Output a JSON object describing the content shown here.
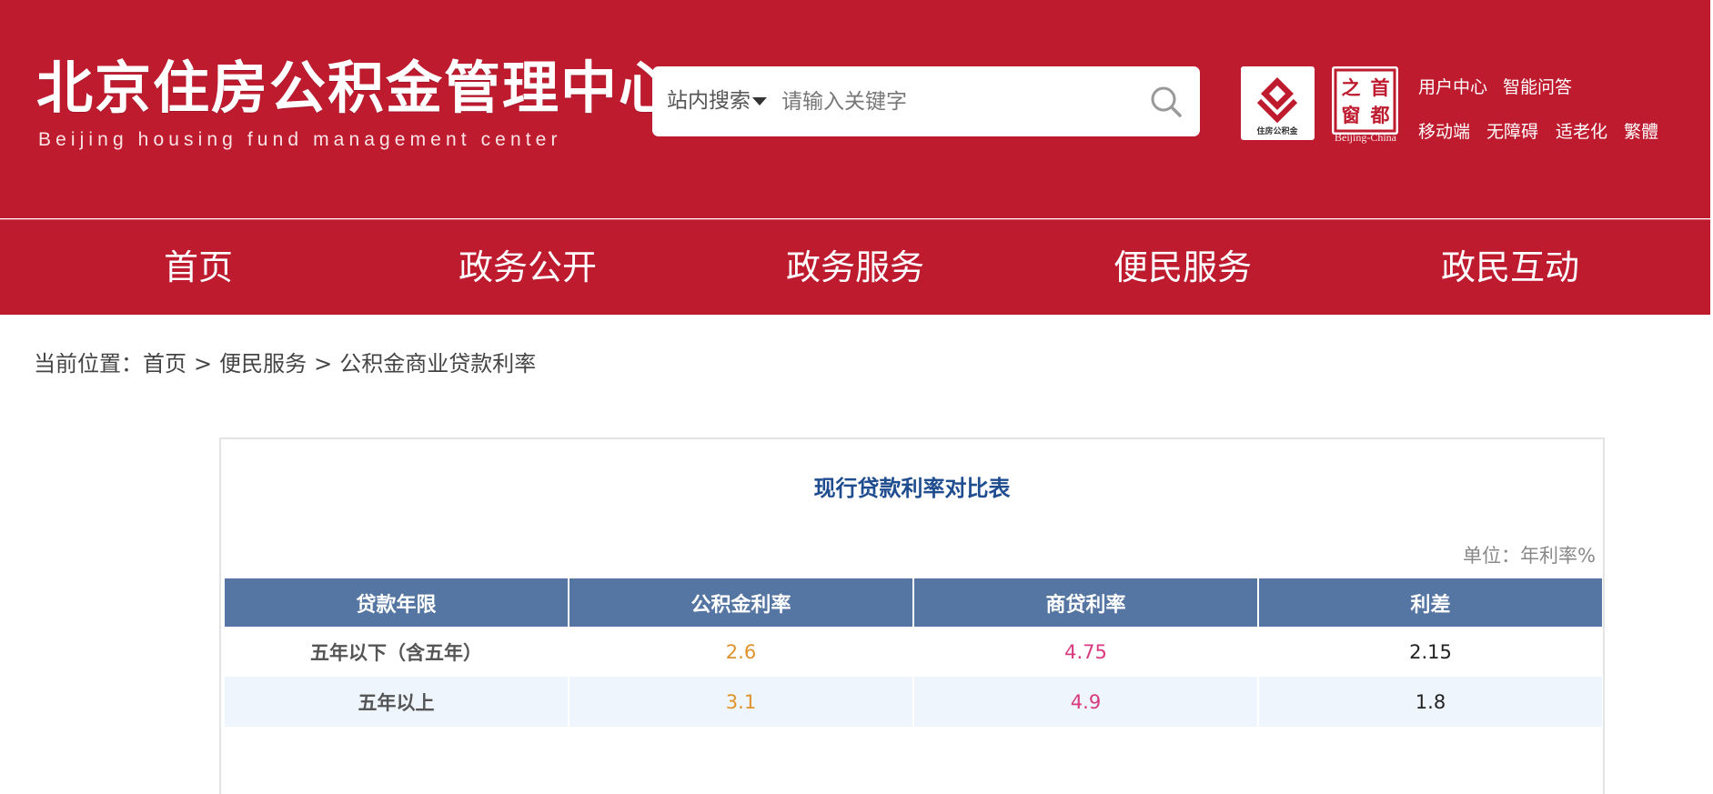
{
  "header": {
    "title": "北京住房公积金管理中心",
    "subtitle": "Beijing housing fund management center",
    "search": {
      "scope_label": "站内搜索",
      "placeholder": "请输入关键字"
    },
    "badge_fund_text": "住房公积金",
    "badge_capital_chars": [
      "首",
      "都",
      "之",
      "窗"
    ],
    "badge_capital_caption": "Beijing-China",
    "links": [
      "用户中心",
      "智能问答",
      "移动端",
      "无障碍",
      "适老化",
      "繁體"
    ],
    "brand_color": "#be1b2f"
  },
  "nav": {
    "items": [
      "首页",
      "政务公开",
      "政务服务",
      "便民服务",
      "政民互动"
    ]
  },
  "breadcrumb": {
    "prefix": "当前位置：",
    "items": [
      "首页",
      "便民服务",
      "公积金商业贷款利率"
    ],
    "separator": ">"
  },
  "rates": {
    "title": "现行贷款利率对比表",
    "unit": "单位：年利率%",
    "headers": [
      "贷款年限",
      "公积金利率",
      "商贷利率",
      "利差"
    ],
    "rows": [
      {
        "term": "五年以下（含五年）",
        "fund_rate": "2.6",
        "commercial_rate": "4.75",
        "diff": "2.15"
      },
      {
        "term": "五年以上",
        "fund_rate": "3.1",
        "commercial_rate": "4.9",
        "diff": "1.8"
      }
    ],
    "header_color": "#5576a2",
    "fund_color": "#e0932c",
    "commercial_color": "#d8397f"
  }
}
